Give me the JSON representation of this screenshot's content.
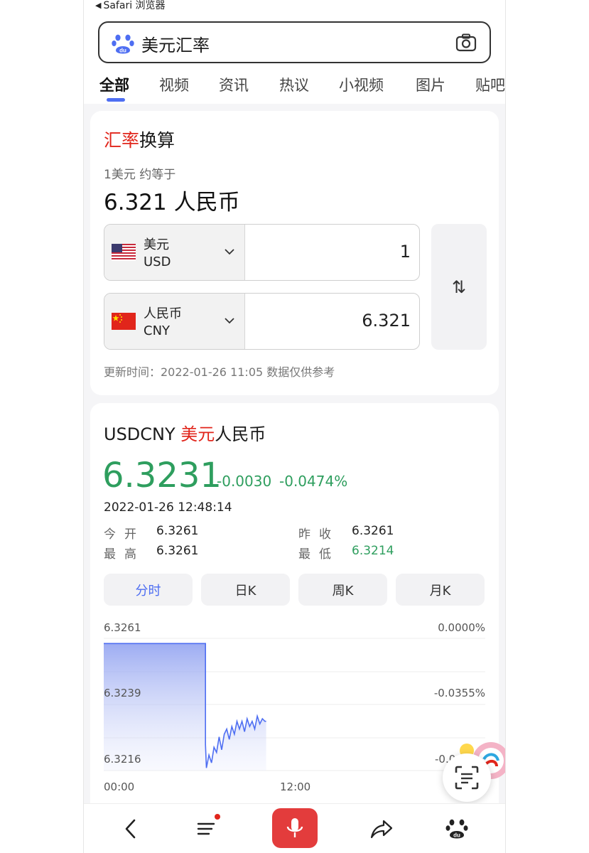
{
  "statusbar": {
    "back_label": "Safari 浏览器"
  },
  "search": {
    "query": "美元汇率"
  },
  "tabs": [
    {
      "label": "全部"
    },
    {
      "label": "视频"
    },
    {
      "label": "资讯"
    },
    {
      "label": "热议"
    },
    {
      "label": "小视频"
    },
    {
      "label": "图片"
    },
    {
      "label": "贴吧"
    }
  ],
  "converter": {
    "title_red": "汇率",
    "title_black": "换算",
    "rate_sub": "1美元 约等于",
    "rate_result": "6.321 人民币",
    "from": {
      "name": "美元",
      "code": "USD",
      "amount": "1"
    },
    "to": {
      "name": "人民币",
      "code": "CNY",
      "amount": "6.321"
    },
    "swap_icon": "⇅",
    "update_text": "更新时间：2022-01-26 11:05 数据仅供参考"
  },
  "quote": {
    "symbol": "USDCNY ",
    "name_red": "美元",
    "name_black": "人民币",
    "price": "6.3231",
    "change": "-0.0030",
    "change_pct": "-0.0474%",
    "timestamp": "2022-01-26 12:48:14",
    "stats": {
      "open_label": "今开",
      "open": "6.3261",
      "prev_close_label": "昨收",
      "prev_close": "6.3261",
      "high_label": "最高",
      "high": "6.3261",
      "low_label": "最低",
      "low": "6.3214"
    },
    "kline_tabs": [
      {
        "label": "分时"
      },
      {
        "label": "日K"
      },
      {
        "label": "周K"
      },
      {
        "label": "月K"
      }
    ],
    "colors": {
      "up_green": "#2e9e5e",
      "accent_blue": "#4e6ef2",
      "brand_red": "#e1251b"
    }
  },
  "chart_data": {
    "type": "area",
    "y_left_ticks": [
      "6.3261",
      "6.3239",
      "6.3216"
    ],
    "y_right_ticks": [
      "0.0000%",
      "-0.0355%",
      "-0.0"
    ],
    "x_ticks": [
      "00:00",
      "12:00"
    ],
    "x_range_hours": [
      0,
      24
    ],
    "ylim": [
      6.3212,
      6.3263
    ],
    "series": [
      {
        "x": [
          0,
          8.0,
          8.0,
          8.1,
          8.3,
          8.5,
          8.7,
          8.9,
          9.1,
          9.3,
          9.5,
          9.7,
          9.9,
          10.1,
          10.3,
          10.5,
          10.7,
          10.9,
          11.1,
          11.3,
          11.5,
          11.7,
          11.9,
          12.1,
          12.3,
          12.5,
          12.7,
          12.8
        ],
        "y": [
          6.3261,
          6.3261,
          6.3222,
          6.3213,
          6.3218,
          6.3215,
          6.3221,
          6.3219,
          6.3225,
          6.322,
          6.3226,
          6.3228,
          6.3224,
          6.3229,
          6.3226,
          6.3231,
          6.3228,
          6.3231,
          6.3227,
          6.3232,
          6.3229,
          6.3231,
          6.3228,
          6.3233,
          6.323,
          6.3232,
          6.3231,
          6.3231
        ]
      }
    ]
  },
  "bottom_nav": [
    {
      "icon": "back-icon"
    },
    {
      "icon": "menu-icon"
    },
    {
      "icon": "mic-icon"
    },
    {
      "icon": "share-icon"
    },
    {
      "icon": "baidu-paw-icon"
    }
  ]
}
